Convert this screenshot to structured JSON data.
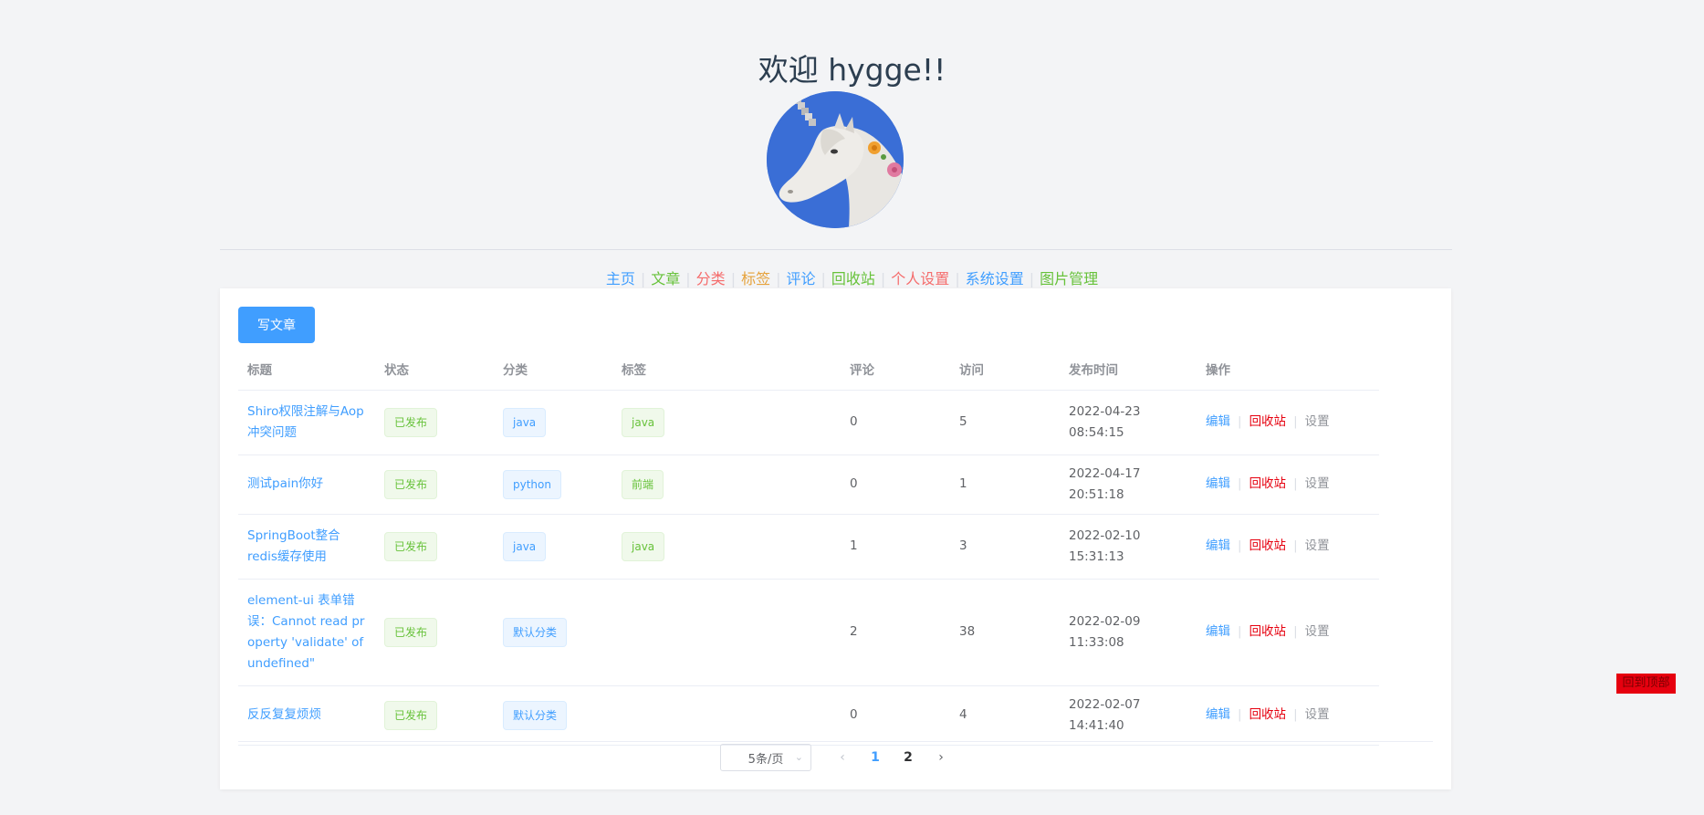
{
  "header": {
    "welcome": "欢迎 hygge!!"
  },
  "nav": {
    "items": [
      {
        "label": "主页",
        "color": "#409eff"
      },
      {
        "label": "文章",
        "color": "#67c23a"
      },
      {
        "label": "分类",
        "color": "#f56c6c"
      },
      {
        "label": "标签",
        "color": "#e6a23c"
      },
      {
        "label": "评论",
        "color": "#409eff"
      },
      {
        "label": "回收站",
        "color": "#67c23a"
      },
      {
        "label": "个人设置",
        "color": "#f56c6c"
      },
      {
        "label": "系统设置",
        "color": "#409eff"
      },
      {
        "label": "图片管理",
        "color": "#67c23a"
      }
    ]
  },
  "toolbar": {
    "write_label": "写文章"
  },
  "table": {
    "headers": {
      "title": "标题",
      "status": "状态",
      "category": "分类",
      "tags": "标签",
      "comments": "评论",
      "views": "访问",
      "published": "发布时间",
      "actions": "操作"
    },
    "rows": [
      {
        "title": "Shiro权限注解与Aop冲突问题",
        "status": "已发布",
        "category": "java",
        "tag": "java",
        "comments": "0",
        "views": "5",
        "published": "2022-04-23 08:54:15"
      },
      {
        "title": "测试pain你好",
        "status": "已发布",
        "category": "python",
        "tag": "前端",
        "comments": "0",
        "views": "1",
        "published": "2022-04-17 20:51:18"
      },
      {
        "title": "SpringBoot整合redis缓存使用",
        "status": "已发布",
        "category": "java",
        "tag": "java",
        "comments": "1",
        "views": "3",
        "published": "2022-02-10 15:31:13"
      },
      {
        "title": "element-ui 表单错误：Cannot read property 'validate' of undefined\"",
        "status": "已发布",
        "category": "默认分类",
        "tag": "",
        "comments": "2",
        "views": "38",
        "published": "2022-02-09 11:33:08"
      },
      {
        "title": "反反复复烦烦",
        "status": "已发布",
        "category": "默认分类",
        "tag": "",
        "comments": "0",
        "views": "4",
        "published": "2022-02-07 14:41:40"
      }
    ],
    "actions": {
      "edit": "编辑",
      "recycle": "回收站",
      "settings": "设置"
    }
  },
  "pagination": {
    "page_size": "5条/页",
    "pages": [
      "1",
      "2"
    ],
    "current": "1"
  },
  "badge": {
    "text": "回到顶部"
  }
}
